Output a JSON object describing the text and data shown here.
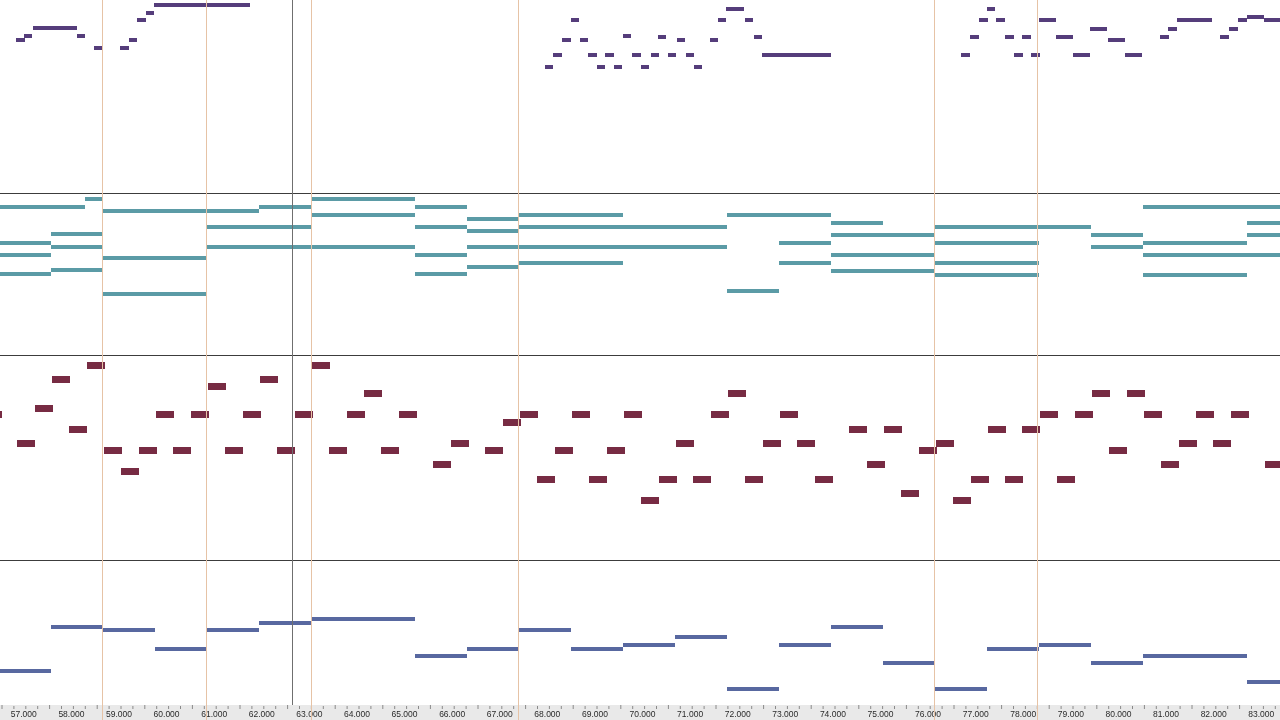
{
  "tracks": [
    {
      "color": "#553d7b"
    },
    {
      "color": "#5b9ba6"
    },
    {
      "color": "#772b43"
    },
    {
      "color": "#5868a0"
    }
  ],
  "ruler": {
    "labels": [
      "57.000",
      "58.000",
      "59.000",
      "60.000",
      "61.000",
      "62.000",
      "63.000",
      "64.000",
      "65.000",
      "66.000",
      "67.000",
      "68.000",
      "69.000",
      "70.000",
      "71.000",
      "72.000",
      "73.000",
      "74.000",
      "75.000",
      "76.000",
      "77.000",
      "78.000",
      "79.000",
      "80.000",
      "81.000",
      "82.000",
      "83.000"
    ]
  }
}
